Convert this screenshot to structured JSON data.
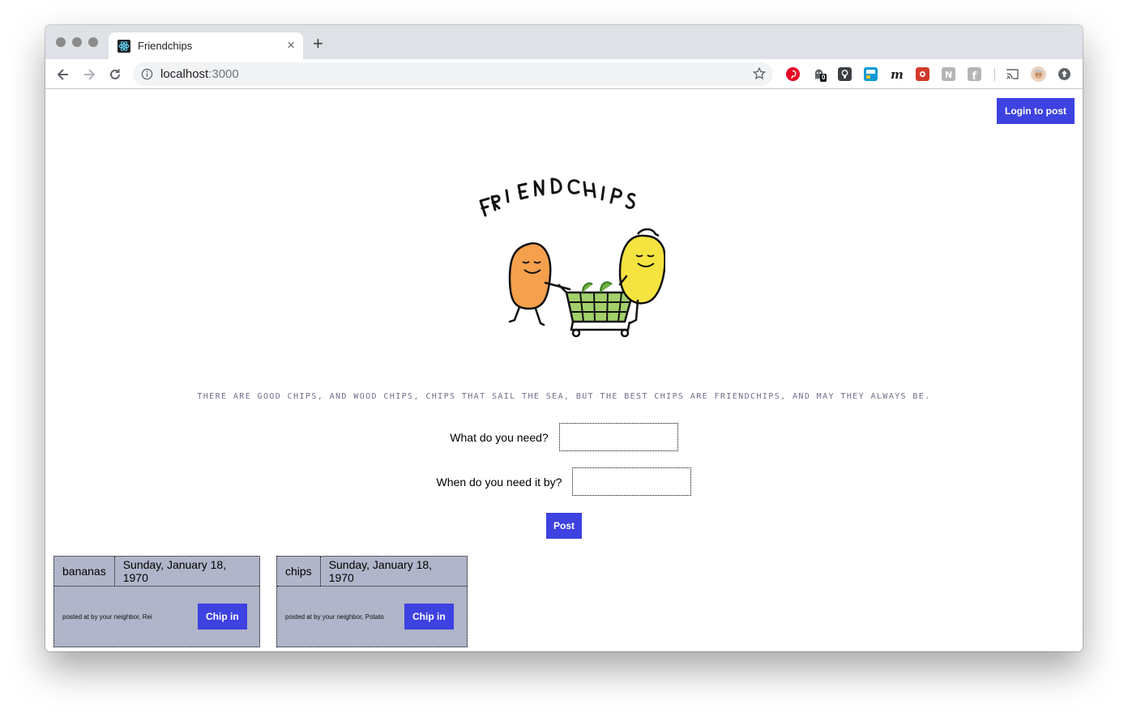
{
  "browser": {
    "tab_title": "Friendchips",
    "tab_close": "×",
    "new_tab": "+",
    "url_host": "localhost",
    "url_port": ":3000",
    "badge_count": "0",
    "extensions": [
      {
        "name": "pinterest-icon",
        "color": "#e60023"
      },
      {
        "name": "ghostery-icon",
        "color": "#5f6368"
      },
      {
        "name": "lightbulb-extension-icon",
        "color": "#3c4043"
      },
      {
        "name": "blue-square-extension-icon",
        "color": "#0a9ad6"
      },
      {
        "name": "m-extension-icon",
        "color": "#202124"
      },
      {
        "name": "red-extension-icon",
        "color": "#d23a2a"
      },
      {
        "name": "notion-extension-icon",
        "color": "#b5b5b5"
      },
      {
        "name": "facebook-extension-icon",
        "color": "#b5b5b5"
      },
      {
        "name": "cast-icon",
        "color": "#5f6368"
      },
      {
        "name": "avatar",
        "color": "#d9b08c"
      },
      {
        "name": "update-icon",
        "color": "#5f6368"
      }
    ]
  },
  "header": {
    "login_label": "Login to post"
  },
  "hero": {
    "tagline": "There are good chips, and wood chips, chips that sail the sea, but the best chips are friendchips, and may they always be."
  },
  "form": {
    "need_label": "What do you need?",
    "need_value": "",
    "by_label": "When do you need it by?",
    "by_value": "",
    "post_label": "Post"
  },
  "colors": {
    "accent": "#3d42e1",
    "card_bg": "#b0b5c9"
  },
  "posts": [
    {
      "item": "bananas",
      "date": "Sunday, January 18, 1970",
      "byline": "posted at by your neighbor, Rei",
      "button": "Chip in"
    },
    {
      "item": "chips",
      "date": "Sunday, January 18, 1970",
      "byline": "posted at by your neighbor, Potato",
      "button": "Chip in"
    }
  ]
}
